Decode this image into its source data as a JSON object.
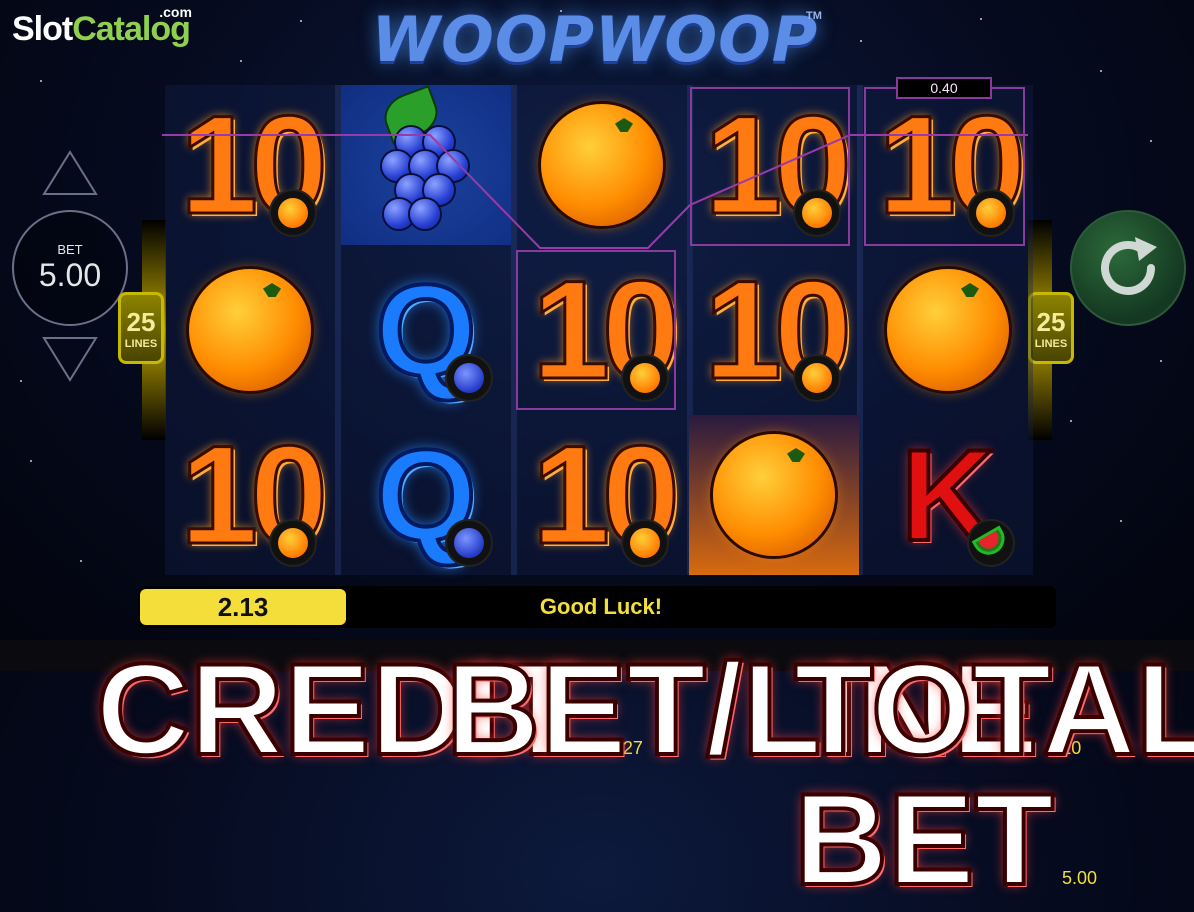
{
  "brand": {
    "part1": "Slot",
    "part2": "Catalog",
    "suffix": ".com"
  },
  "game": {
    "title": "WOOPWOOP",
    "trademark": "TM"
  },
  "bet": {
    "label": "BET",
    "value": "5.00"
  },
  "lines": {
    "count": "25",
    "label": "LINES"
  },
  "win_label": "0.40",
  "reels": [
    [
      "10 (orange)",
      "orange",
      "10 (orange)"
    ],
    [
      "grapes",
      "Q (grapes)",
      "Q (grapes)"
    ],
    [
      "orange",
      "10 (orange)",
      "10 (orange)"
    ],
    [
      "10 (orange)",
      "10 (orange)",
      "orange"
    ],
    [
      "10 (orange)",
      "orange",
      "K (melon)"
    ]
  ],
  "win_value": "2.13",
  "message": "Good Luck!",
  "footer": {
    "credit_label": "CREDIT",
    "credit_value": "990.27",
    "betline_label": "BET/LINE",
    "betline_value": "0.20",
    "totalbet_label": "TOTAL BET",
    "totalbet_value": "5.00"
  },
  "icons": {
    "up": "triangle-up-icon",
    "down": "triangle-down-icon",
    "spin": "refresh-icon"
  }
}
